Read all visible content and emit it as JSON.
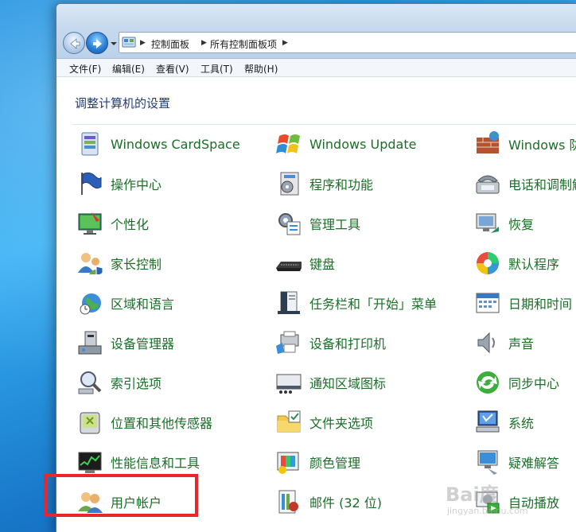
{
  "address_bar": {
    "crumbs": [
      "控制面板",
      "所有控制面板项"
    ]
  },
  "menu": {
    "items": [
      "文件(F)",
      "编辑(E)",
      "查看(V)",
      "工具(T)",
      "帮助(H)"
    ]
  },
  "page": {
    "title": "调整计算机的设置"
  },
  "columns": [
    [
      {
        "label": "Windows CardSpace",
        "icon": "cardspace-icon"
      },
      {
        "label": "操作中心",
        "icon": "action-center-flag-icon"
      },
      {
        "label": "个性化",
        "icon": "personalization-icon"
      },
      {
        "label": "家长控制",
        "icon": "parental-controls-icon"
      },
      {
        "label": "区域和语言",
        "icon": "region-language-icon"
      },
      {
        "label": "设备管理器",
        "icon": "device-manager-icon"
      },
      {
        "label": "索引选项",
        "icon": "indexing-options-icon"
      },
      {
        "label": "位置和其他传感器",
        "icon": "location-sensors-icon"
      },
      {
        "label": "性能信息和工具",
        "icon": "performance-icon"
      },
      {
        "label": "用户帐户",
        "icon": "user-accounts-icon"
      }
    ],
    [
      {
        "label": "Windows Update",
        "icon": "windows-update-icon"
      },
      {
        "label": "程序和功能",
        "icon": "programs-features-icon"
      },
      {
        "label": "管理工具",
        "icon": "admin-tools-icon"
      },
      {
        "label": "键盘",
        "icon": "keyboard-icon"
      },
      {
        "label": "任务栏和「开始」菜单",
        "icon": "taskbar-start-menu-icon"
      },
      {
        "label": "设备和打印机",
        "icon": "devices-printers-icon"
      },
      {
        "label": "通知区域图标",
        "icon": "notification-area-icon"
      },
      {
        "label": "文件夹选项",
        "icon": "folder-options-icon"
      },
      {
        "label": "颜色管理",
        "icon": "color-management-icon"
      },
      {
        "label": "邮件 (32 位)",
        "icon": "mail-icon"
      }
    ],
    [
      {
        "label": "Windows 防",
        "icon": "firewall-icon"
      },
      {
        "label": "电话和调制解",
        "icon": "phone-modem-icon"
      },
      {
        "label": "恢复",
        "icon": "recovery-icon"
      },
      {
        "label": "默认程序",
        "icon": "default-programs-icon"
      },
      {
        "label": "日期和时间",
        "icon": "date-time-icon"
      },
      {
        "label": "声音",
        "icon": "sound-icon"
      },
      {
        "label": "同步中心",
        "icon": "sync-center-icon"
      },
      {
        "label": "系统",
        "icon": "system-icon"
      },
      {
        "label": "疑难解答",
        "icon": "troubleshooting-icon"
      },
      {
        "label": "自动播放",
        "icon": "autoplay-icon"
      }
    ]
  ],
  "watermark": {
    "main": "Bai度",
    "sub": "jingyan.baidu.com"
  },
  "colors": {
    "link_green": "#1b6e27",
    "title_blue": "#1e3e7a",
    "highlight_red": "#e8262b"
  }
}
